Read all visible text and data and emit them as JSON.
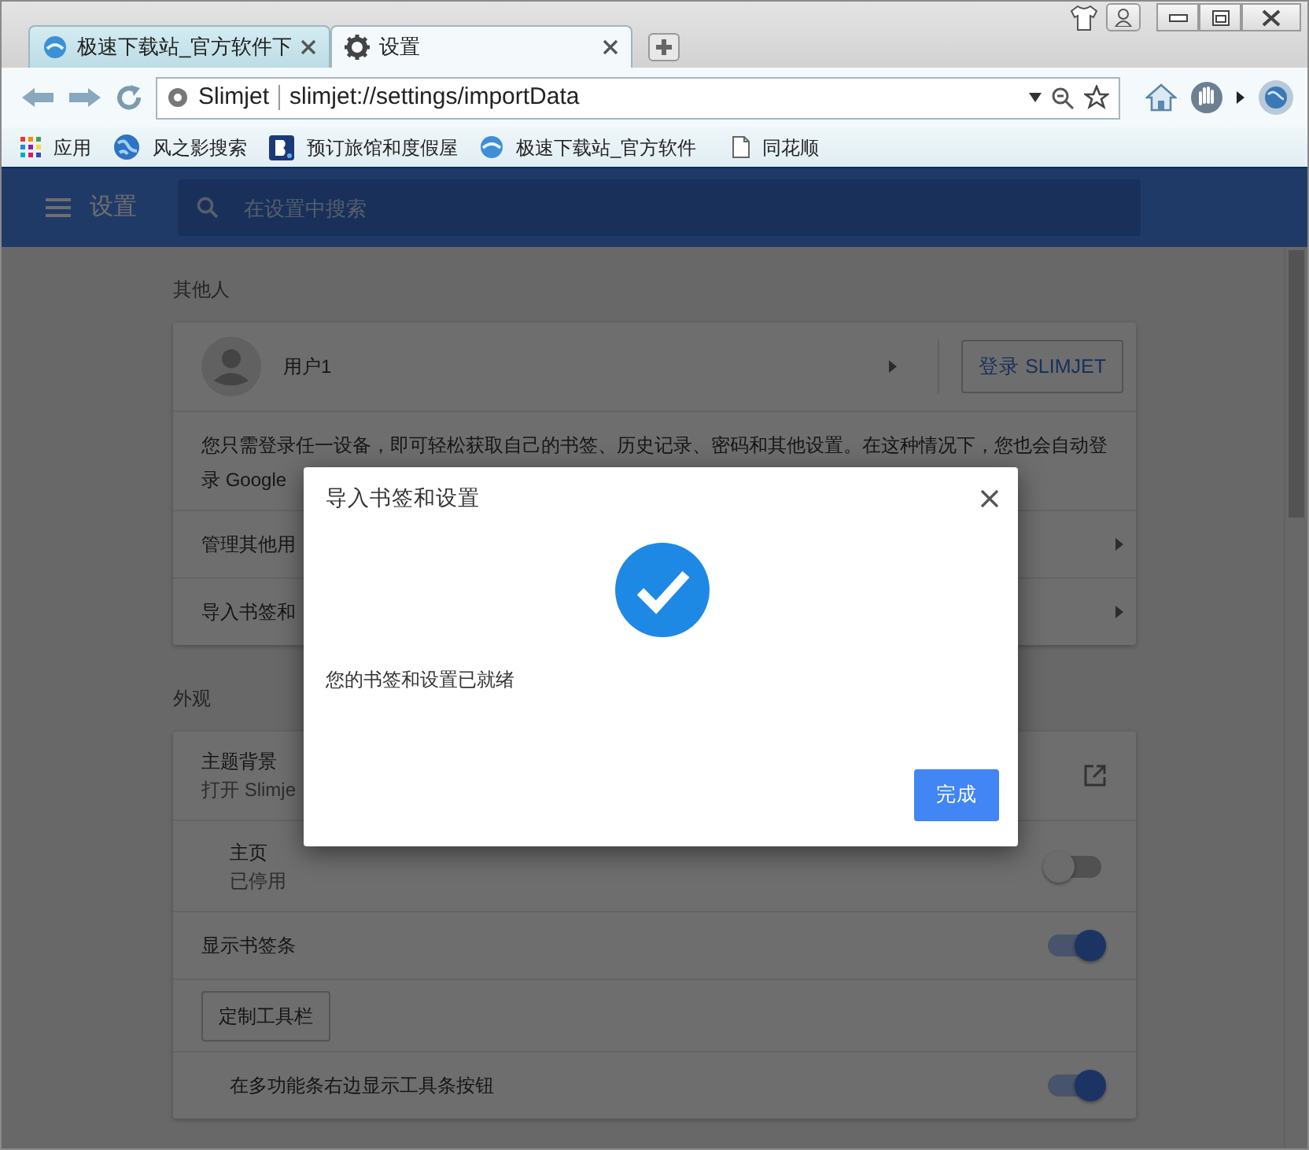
{
  "tabs": [
    {
      "label": "极速下载站_官方软件下",
      "selected": false
    },
    {
      "label": "设置",
      "selected": true
    }
  ],
  "address_bar": {
    "site": "Slimjet",
    "url": "slimjet://settings/importData"
  },
  "bookmarks": [
    {
      "label": "应用"
    },
    {
      "label": "风之影搜索"
    },
    {
      "label": "预订旅馆和度假屋"
    },
    {
      "label": "极速下载站_官方软件"
    },
    {
      "label": "同花顺"
    }
  ],
  "settings_header": {
    "title": "设置",
    "placeholder": "在设置中搜索"
  },
  "sections": [
    {
      "heading": "其他人",
      "rows": [
        {
          "kind": "profile",
          "name": "用户1",
          "button": "登录 SLIMJET"
        },
        {
          "kind": "text",
          "text": "您只需登录任一设备，即可轻松获取自己的书签、历史记录、密码和其他设置。在这种情况下，您也会自动登录 Google"
        },
        {
          "kind": "link",
          "label": "管理其他用"
        },
        {
          "kind": "link",
          "label": "导入书签和"
        }
      ]
    },
    {
      "heading": "外观",
      "rows": [
        {
          "kind": "external",
          "label": "主题背景",
          "subtitle": "打开 Slimje"
        },
        {
          "kind": "subtoggle",
          "label": "主页",
          "subtitle": "已停用",
          "on": false
        },
        {
          "kind": "toggle",
          "label": "显示书签条",
          "on": true
        },
        {
          "kind": "button",
          "label": "定制工具栏"
        },
        {
          "kind": "subtoggle",
          "label": "在多功能条右边显示工具条按钮",
          "on": true
        }
      ]
    }
  ],
  "dialog": {
    "title": "导入书签和设置",
    "message": "您的书签和设置已就绪",
    "button": "完成"
  }
}
